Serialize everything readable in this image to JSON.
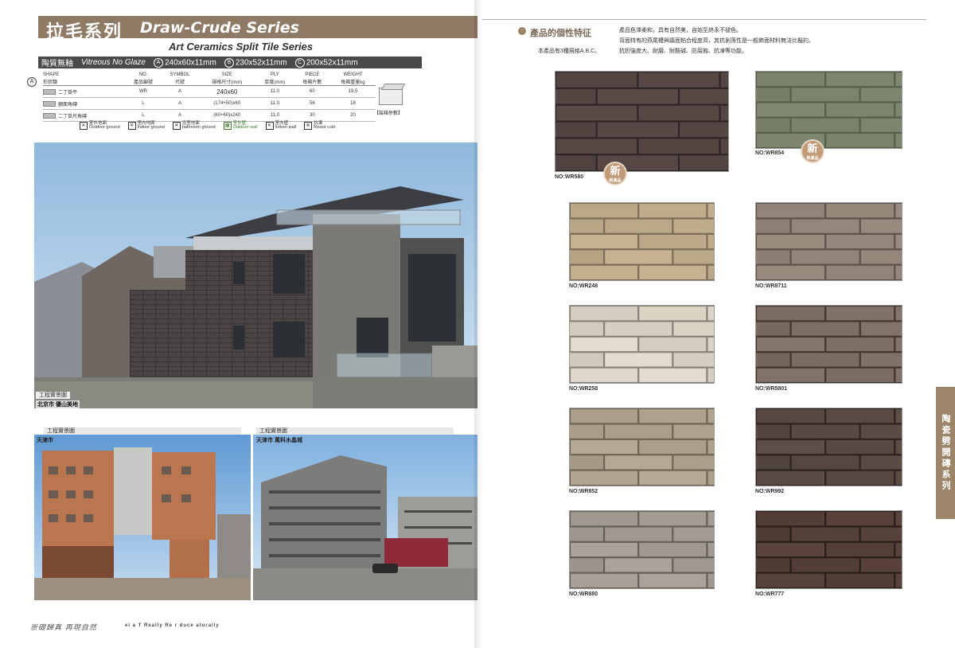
{
  "header": {
    "title_cn": "拉毛系列",
    "title_en": "Draw-Crude Series",
    "subtitle": "Art Ceramics Split Tile Series"
  },
  "glaze": {
    "label_cn": "陶質無釉",
    "label_en": "Vitreous No Glaze",
    "sizes": [
      {
        "mark": "A",
        "size": "240x60x11mm"
      },
      {
        "mark": "B",
        "size": "230x52x11mm"
      },
      {
        "mark": "C",
        "size": "200x52x11mm"
      }
    ]
  },
  "spec_table": {
    "marker": "A",
    "headers_en": [
      "SHAPE",
      "NO.",
      "SYMBOL",
      "SIZE",
      "PLY",
      "PIECE",
      "WEIGHT"
    ],
    "headers_cn": [
      "形狀類",
      "產品編號",
      "代號",
      "規格尺寸(mm)",
      "厚度(mm)",
      "每箱片數",
      "每箱重量kg"
    ],
    "rows": [
      [
        "二丁掛平",
        "WR",
        "A",
        "240x60",
        "11.0",
        "60",
        "19.5"
      ],
      [
        "額面角磚",
        "L",
        "A",
        "(174+50)x60",
        "11.0",
        "56",
        "18"
      ],
      [
        "二丁掛尺角磚",
        "L",
        "A",
        "(60+60)x240",
        "11.0",
        "30",
        "20"
      ]
    ],
    "box_label": "【裝箱參數】"
  },
  "usage_icons": [
    {
      "icon": "outdoor-ground-icon",
      "cn": "室外地面",
      "en": "Outdoor ground",
      "active": false
    },
    {
      "icon": "indoor-ground-icon",
      "cn": "室內地面",
      "en": "Indoor ground",
      "active": false
    },
    {
      "icon": "bathroom-ground-icon",
      "cn": "浴室地面",
      "en": "bathroom ground",
      "active": false
    },
    {
      "icon": "outdoor-wall-icon",
      "cn": "室外壁",
      "en": "Outdoor wall",
      "active": true
    },
    {
      "icon": "indoor-wall-icon",
      "cn": "室內壁",
      "en": "Indoor wall",
      "active": false
    },
    {
      "icon": "resist-cold-icon",
      "cn": "抗凍",
      "en": "Resist cold",
      "active": false
    }
  ],
  "photos": {
    "main": {
      "tag": "工程實景圖",
      "city": "北京市 優山美地"
    },
    "bottom_left": {
      "tag": "工程實景圖",
      "city": "天津市"
    },
    "bottom_right": {
      "tag": "工程實景圖",
      "city": "天津市 萬科水晶城"
    }
  },
  "footer": {
    "cn": "崇礎歸真 再現自然",
    "en": "ei a T Really Re r duce aturally"
  },
  "features": {
    "title": "產品的個性特征",
    "spec_note": "本產品有3種規格A.B.C。",
    "lines": [
      "產品色澤柔和，具有自然美，自始至終永不褪色。",
      "背面特有的燕尾槽與牆面粘合程度高，其抗剝落性是一般飾面材料無法比擬的。",
      "抗折強度大、耐磨、耐酸碱、防腐蝕、抗凍等功能。"
    ]
  },
  "tiles": [
    {
      "code": "NO:WR580",
      "base": "#5a4a47",
      "mortar": "#2e2624",
      "new": true,
      "new_cn": "新",
      "new_sub": "新產品"
    },
    {
      "code": "NO:WR854",
      "base": "#7f8870",
      "mortar": "#55604a",
      "new": true,
      "new_cn": "新",
      "new_sub": "新產品"
    },
    {
      "code": "NO:WR248",
      "base": "#c6b291",
      "mortar": "#7c6d58",
      "new": false
    },
    {
      "code": "NO:WR8711",
      "base": "#9a8c7f",
      "mortar": "#5e5148",
      "new": false
    },
    {
      "code": "NO:WR258",
      "base": "#e3dbcd",
      "mortar": "#8a8276",
      "new": false
    },
    {
      "code": "NO:WR5801",
      "base": "#84766a",
      "mortar": "#3f3630",
      "new": false
    },
    {
      "code": "NO:WR852",
      "base": "#b6a993",
      "mortar": "#6e6454",
      "new": false
    },
    {
      "code": "NO:WR992",
      "base": "#5d4e47",
      "mortar": "#2c2420",
      "new": false
    },
    {
      "code": "NO:WR880",
      "base": "#aaa39a",
      "mortar": "#646058",
      "new": false
    },
    {
      "code": "NO:WR777",
      "base": "#5a443c",
      "mortar": "#2a1e1a",
      "new": false
    }
  ],
  "side_tab": "陶瓷劈開磚系列"
}
